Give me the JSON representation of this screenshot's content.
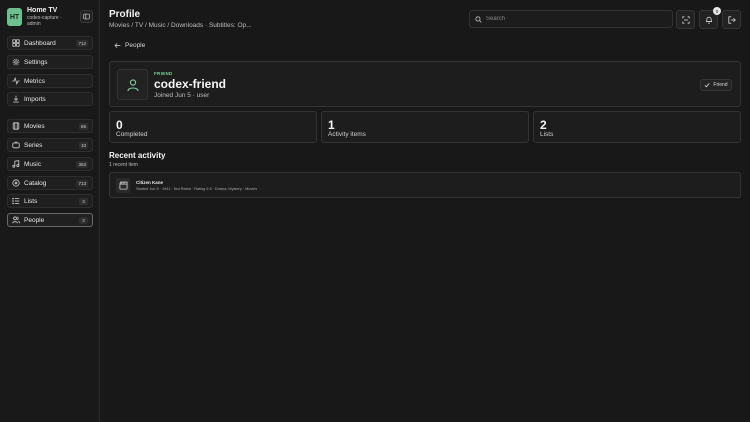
{
  "brand": {
    "initials": "HT",
    "title": "Home TV",
    "subtitle": "codex-capture · admin"
  },
  "sidebar": {
    "groups": [
      [
        {
          "label": "Dashboard",
          "count": "712",
          "icon": "dashboard-icon"
        },
        {
          "label": "Settings",
          "count": "",
          "icon": "gear-icon"
        },
        {
          "label": "Metrics",
          "count": "",
          "icon": "activity-icon"
        },
        {
          "label": "Imports",
          "count": "",
          "icon": "download-icon"
        }
      ],
      [
        {
          "label": "Movies",
          "count": "65",
          "icon": "film-icon"
        },
        {
          "label": "Series",
          "count": "10",
          "icon": "tv-icon"
        },
        {
          "label": "Music",
          "count": "363",
          "icon": "music-icon"
        },
        {
          "label": "Catalog",
          "count": "713",
          "icon": "catalog-icon"
        },
        {
          "label": "Lists",
          "count": "3",
          "icon": "list-icon"
        },
        {
          "label": "People",
          "count": "3",
          "icon": "people-icon",
          "active": true
        }
      ]
    ]
  },
  "header": {
    "title": "Profile",
    "breadcrumbs": "Movies / TV / Music / Downloads · Subtitles: Op...",
    "search_placeholder": "Search",
    "notification_count": "0"
  },
  "back": {
    "label": "People"
  },
  "profile": {
    "role": "FRIEND",
    "username": "codex-friend",
    "joined": "Joined Jun 5 · user",
    "friend_button": "Friend"
  },
  "stats": [
    {
      "value": "0",
      "label": "Completed"
    },
    {
      "value": "1",
      "label": "Activity items"
    },
    {
      "value": "2",
      "label": "Lists"
    }
  ],
  "recent": {
    "title": "Recent activity",
    "subtitle": "1 recent item",
    "items": [
      {
        "title": "Citizen Kane",
        "meta": "Started Jun 5 · 1941 · Not Rated · Rating 9.8 · Drama, Mystery · Movies"
      }
    ]
  },
  "colors": {
    "background": "#181818",
    "accent": "#6fbf8f",
    "role_text": "#7fd39f"
  }
}
